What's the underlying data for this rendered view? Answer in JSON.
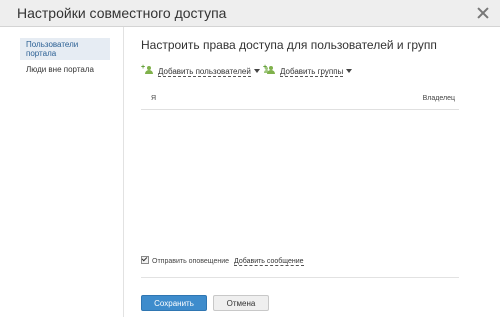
{
  "dialog": {
    "title": "Настройки совместного доступа"
  },
  "sidebar": {
    "items": [
      {
        "label": "Пользователи портала"
      },
      {
        "label": "Люди вне портала"
      }
    ]
  },
  "main": {
    "heading": "Настроить права доступа для пользователей и групп",
    "add_users": "Добавить пользователей",
    "add_groups": "Добавить группы",
    "table": {
      "columns": [
        "Я",
        "Владелец"
      ]
    },
    "notify_label": "Отправить оповещение",
    "notify_checked": true,
    "add_message": "Добавить сообщение"
  },
  "buttons": {
    "save": "Сохранить",
    "cancel": "Отмена"
  },
  "colors": {
    "accent": "#3e8ccc",
    "icon_green": "#7fb14b"
  },
  "icons": [
    "close-icon",
    "add-user-icon",
    "add-group-icon",
    "caret-down-icon",
    "checkbox"
  ]
}
